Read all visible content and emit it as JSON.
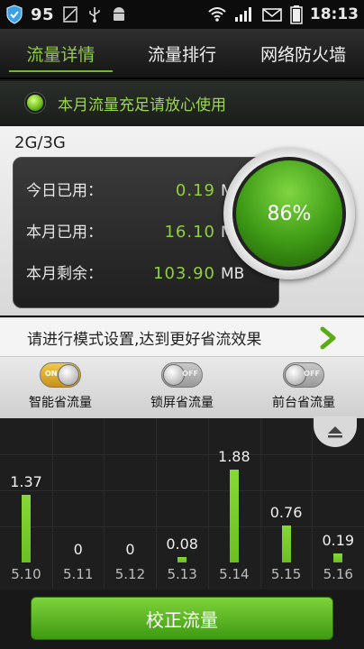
{
  "status_bar": {
    "battery_level": "95",
    "time": "18:13",
    "icons": [
      "shield-icon",
      "sim-icon",
      "usb-icon",
      "android-icon",
      "wifi-icon",
      "signal-icon",
      "mail-icon",
      "battery-icon"
    ]
  },
  "tabs": [
    {
      "label": "流量详情",
      "active": true
    },
    {
      "label": "流量排行",
      "active": false
    },
    {
      "label": "网络防火墙",
      "active": false
    }
  ],
  "notice": {
    "text": "本月流量充足请放心使用"
  },
  "stats": {
    "network": "2G/3G",
    "rows": [
      {
        "label": "今日已用：",
        "value": "0.19",
        "unit": "MB"
      },
      {
        "label": "本月已用：",
        "value": "16.10",
        "unit": "MB"
      },
      {
        "label": "本月剩余：",
        "value": "103.90",
        "unit": "MB"
      }
    ],
    "gauge_percent": "86%"
  },
  "tip": {
    "text": "请进行模式设置,达到更好省流效果"
  },
  "modes": [
    {
      "label": "智能省流量",
      "state": "ON",
      "on": true
    },
    {
      "label": "锁屏省流量",
      "state": "OFF",
      "on": false
    },
    {
      "label": "前台省流量",
      "state": "OFF",
      "on": false
    }
  ],
  "chart_data": {
    "type": "bar",
    "categories": [
      "5.10",
      "5.11",
      "5.12",
      "5.13",
      "5.14",
      "5.15",
      "5.16"
    ],
    "values": [
      1.37,
      0,
      0,
      0.08,
      1.88,
      0.76,
      0.19
    ],
    "value_labels": [
      "1.37",
      "0",
      "0",
      "0.08",
      "1.88",
      "0.76",
      "0.19"
    ],
    "ylim": [
      0,
      2.2
    ],
    "colors": {
      "bar": "#6cbf22"
    }
  },
  "bottom_button": {
    "label": "校正流量"
  }
}
